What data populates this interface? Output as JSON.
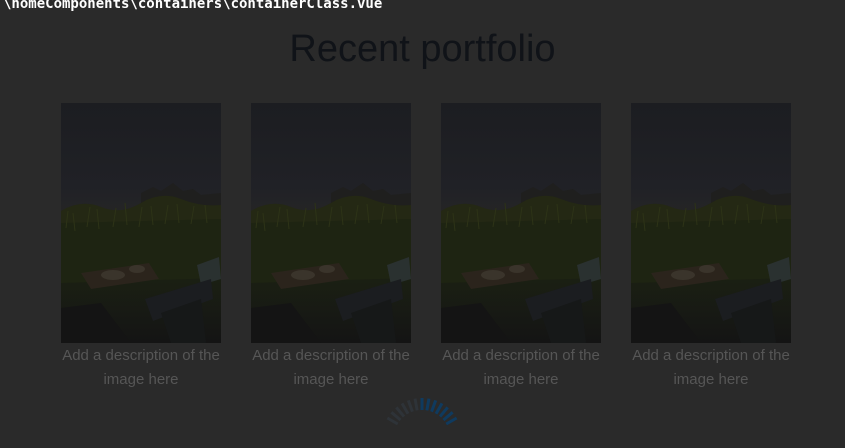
{
  "overlay": {
    "path_text": "\\homeComponents\\containers\\containerClass.vue"
  },
  "portfolio": {
    "title": "Recent portfolio",
    "items": [
      {
        "caption": "Add a description of the image here"
      },
      {
        "caption": "Add a description of the image here"
      },
      {
        "caption": "Add a description of the image here"
      },
      {
        "caption": "Add a description of the image here"
      }
    ]
  },
  "colors": {
    "background": "#2a2a2a",
    "title": "#101318",
    "caption": "#565656",
    "overlay_text": "#ffffff",
    "spinner_accent": "#0f3a5e"
  }
}
